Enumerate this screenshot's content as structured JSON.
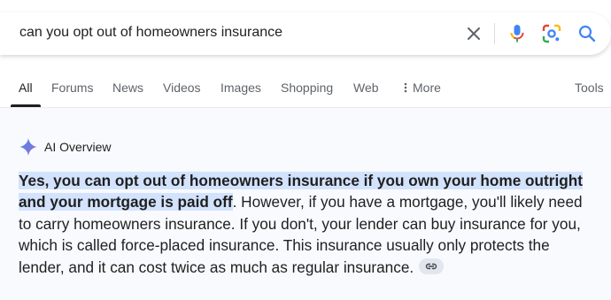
{
  "search": {
    "query": "can you opt out of homeowners insurance"
  },
  "tabs": [
    {
      "label": "All",
      "active": true
    },
    {
      "label": "Forums"
    },
    {
      "label": "News"
    },
    {
      "label": "Videos"
    },
    {
      "label": "Images"
    },
    {
      "label": "Shopping"
    },
    {
      "label": "Web"
    },
    {
      "label": "More"
    }
  ],
  "tools_label": "Tools",
  "ai_overview": {
    "title": "AI Overview",
    "highlight": "Yes, you can opt out of homeowners insurance if you own your home outright and your mortgage is paid off",
    "body": ". However, if you have a mortgage, you'll likely need to carry homeowners insurance. If you don't, your lender can buy insurance for you, which is called force-placed insurance. This insurance usually only protects the lender, and it can cost twice as much as regular insurance."
  },
  "icons": {
    "clear": "close-icon",
    "mic": "microphone-icon",
    "lens": "google-lens-icon",
    "search": "search-icon",
    "more": "vertical-dots-icon",
    "sparkle": "gemini-sparkle-icon",
    "link": "link-icon"
  },
  "colors": {
    "accent_blue": "#4285f4",
    "highlight_bg": "#d3e3fd",
    "panel_bg": "#f8fafd"
  }
}
